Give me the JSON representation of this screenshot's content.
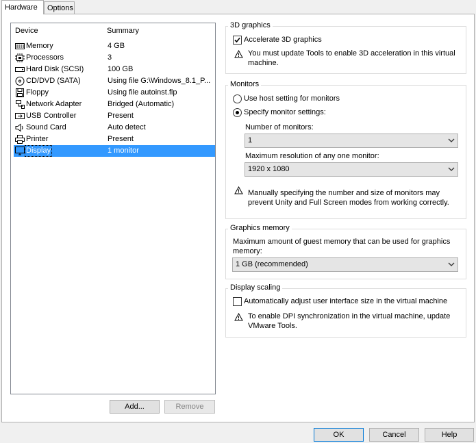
{
  "tabs": [
    {
      "label": "Hardware",
      "active": true
    },
    {
      "label": "Options",
      "active": false
    }
  ],
  "device_list": {
    "headers": {
      "device": "Device",
      "summary": "Summary"
    },
    "rows": [
      {
        "name": "Memory",
        "summary": "4 GB",
        "icon": "memory-icon"
      },
      {
        "name": "Processors",
        "summary": "3",
        "icon": "processor-icon"
      },
      {
        "name": "Hard Disk (SCSI)",
        "summary": "100 GB",
        "icon": "hard-disk-icon"
      },
      {
        "name": "CD/DVD (SATA)",
        "summary": "Using file G:\\Windows_8.1_P...",
        "icon": "cd-dvd-icon"
      },
      {
        "name": "Floppy",
        "summary": "Using file autoinst.flp",
        "icon": "floppy-icon"
      },
      {
        "name": "Network Adapter",
        "summary": "Bridged (Automatic)",
        "icon": "network-adapter-icon"
      },
      {
        "name": "USB Controller",
        "summary": "Present",
        "icon": "usb-icon"
      },
      {
        "name": "Sound Card",
        "summary": "Auto detect",
        "icon": "speaker-icon"
      },
      {
        "name": "Printer",
        "summary": "Present",
        "icon": "printer-icon"
      },
      {
        "name": "Display",
        "summary": "1 monitor",
        "icon": "display-icon",
        "selected": true
      }
    ]
  },
  "buttons": {
    "add": "Add...",
    "remove": "Remove",
    "ok": "OK",
    "cancel": "Cancel",
    "help": "Help"
  },
  "graphics3d": {
    "title": "3D graphics",
    "accelerate_label": "Accelerate 3D graphics",
    "accelerate_checked": true,
    "warning_line1": "You must update Tools to enable 3D acceleration in this virtual",
    "warning_line2": "machine."
  },
  "monitors": {
    "title": "Monitors",
    "use_host_label": "Use host setting for monitors",
    "specify_label": "Specify monitor settings:",
    "selected_option": "specify",
    "count_label": "Number of monitors:",
    "count_value": "1",
    "resolution_label": "Maximum resolution of any one monitor:",
    "resolution_value": "1920 x 1080",
    "warning_line1": "Manually specifying the number and size of monitors may",
    "warning_line2": "prevent Unity and Full Screen modes from working correctly."
  },
  "graphics_memory": {
    "title": "Graphics memory",
    "desc_line1": "Maximum amount of guest memory that can be used for graphics",
    "desc_line2": "memory:",
    "value": "1 GB (recommended)"
  },
  "display_scaling": {
    "title": "Display scaling",
    "auto_adjust_label": "Automatically adjust user interface size in the virtual machine",
    "auto_adjust_checked": false,
    "warning_line1": "To enable DPI synchronization in the virtual machine, update",
    "warning_line2": "VMware Tools."
  }
}
